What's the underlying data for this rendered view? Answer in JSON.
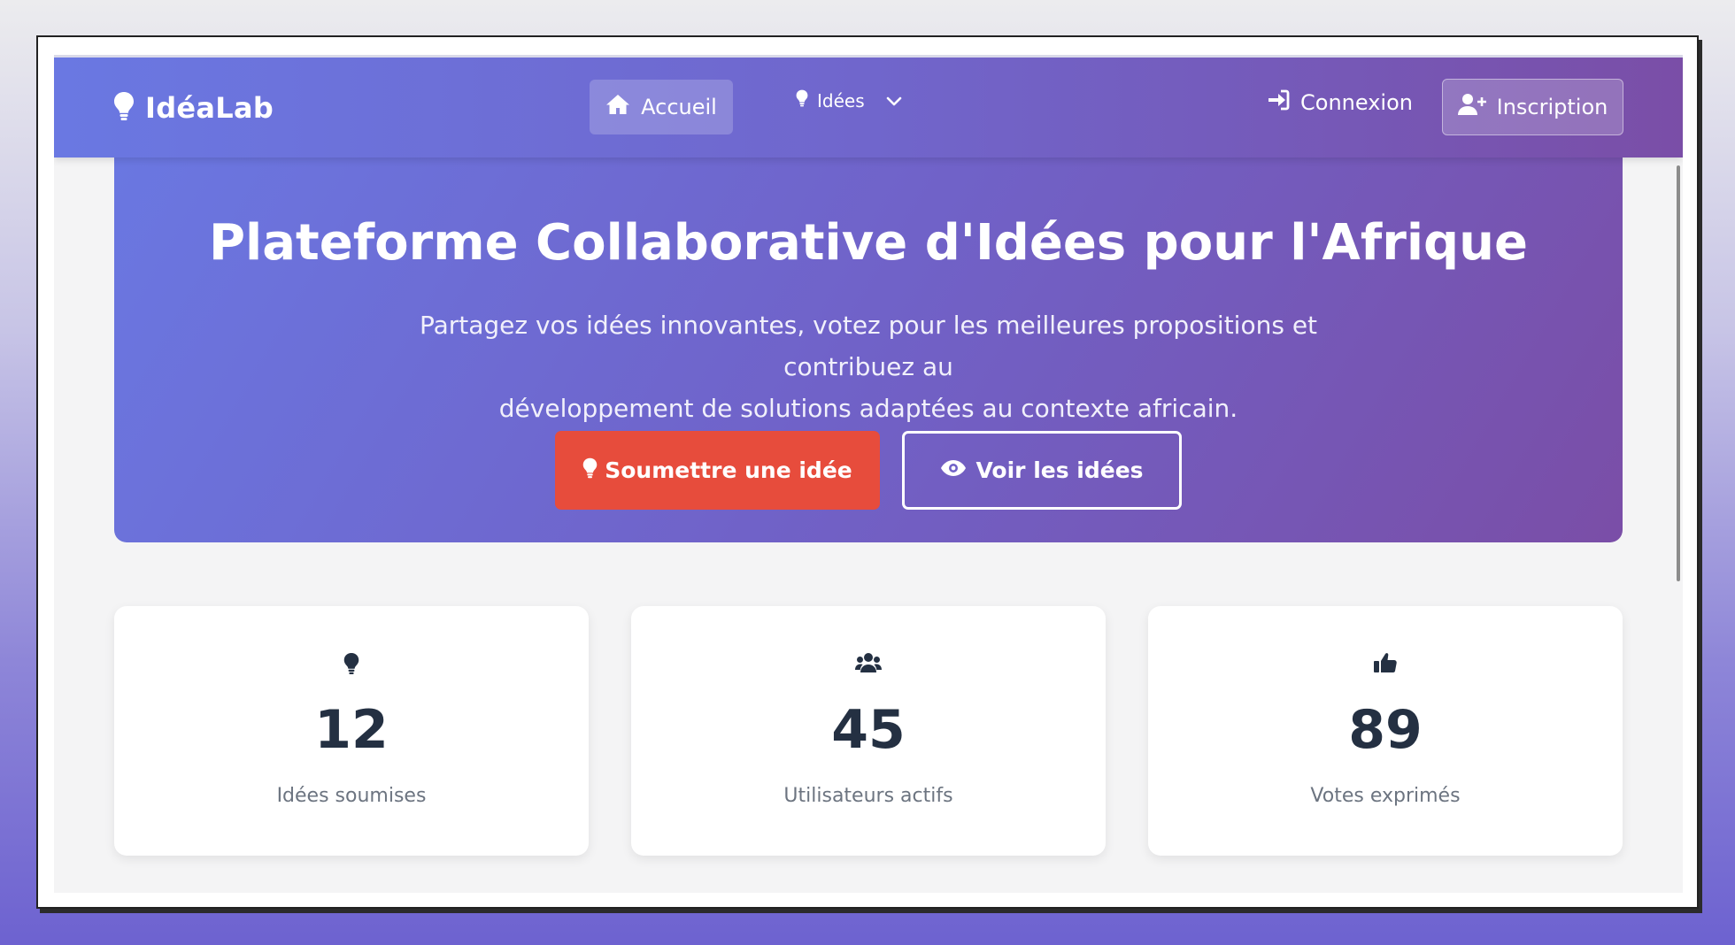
{
  "navbar": {
    "brand": "IdéaLab",
    "items": [
      {
        "label": "Accueil",
        "icon": "home-icon",
        "active": true
      },
      {
        "label": "Idées",
        "icon": "lightbulb-icon",
        "dropdown": true
      },
      {
        "label": "Connexion",
        "icon": "sign-in-icon"
      },
      {
        "label": "Inscription",
        "icon": "user-plus-icon"
      }
    ]
  },
  "hero": {
    "title": "Plateforme Collaborative d'Idées pour l'Afrique",
    "subtitle_line1": "Partagez vos idées innovantes, votez pour les meilleures propositions et contribuez au",
    "subtitle_line2": "développement de solutions adaptées au contexte africain.",
    "primary_button": "Soumettre une idée",
    "secondary_button": "Voir les idées"
  },
  "stats": [
    {
      "icon": "lightbulb-icon",
      "value": "12",
      "label": "Idées soumises"
    },
    {
      "icon": "users-icon",
      "value": "45",
      "label": "Utilisateurs actifs"
    },
    {
      "icon": "thumbs-up-icon",
      "value": "89",
      "label": "Votes exprimés"
    }
  ],
  "colors": {
    "gradient_start": "#6a78e2",
    "gradient_end": "#7a4ea7",
    "primary_button": "#e74c3c",
    "stat_number": "#243042",
    "stat_label": "#6c7480"
  }
}
